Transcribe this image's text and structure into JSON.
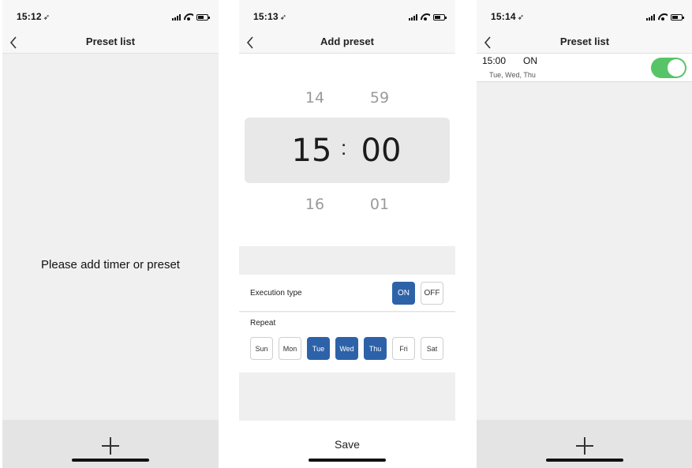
{
  "screens": [
    {
      "status_time": "15:12",
      "nav_title": "Preset list",
      "empty_message": "Please add timer or preset"
    },
    {
      "status_time": "15:13",
      "nav_title": "Add preset",
      "picker": {
        "hour_prev": "14",
        "hour": "15",
        "hour_next": "16",
        "separator": ":",
        "minute_prev": "59",
        "minute": "00",
        "minute_next": "01"
      },
      "execution_label": "Execution type",
      "execution_options": [
        {
          "label": "ON",
          "selected": true
        },
        {
          "label": "OFF",
          "selected": false
        }
      ],
      "repeat_label": "Repeat",
      "days": [
        {
          "label": "Sun",
          "selected": false
        },
        {
          "label": "Mon",
          "selected": false
        },
        {
          "label": "Tue",
          "selected": true
        },
        {
          "label": "Wed",
          "selected": true
        },
        {
          "label": "Thu",
          "selected": true
        },
        {
          "label": "Fri",
          "selected": false
        },
        {
          "label": "Sat",
          "selected": false
        }
      ],
      "save_label": "Save"
    },
    {
      "status_time": "15:14",
      "nav_title": "Preset list",
      "preset": {
        "time": "15:00",
        "action": "ON",
        "days": "Tue, Wed, Thu",
        "enabled": true
      }
    }
  ],
  "colors": {
    "accent": "#2d62a9",
    "toggle_on": "#58c468",
    "background": "#f0f0f0"
  },
  "icons": [
    "status-arrow-icon",
    "signal-icon",
    "wifi-icon",
    "battery-icon",
    "back-chevron-icon",
    "plus-icon"
  ]
}
